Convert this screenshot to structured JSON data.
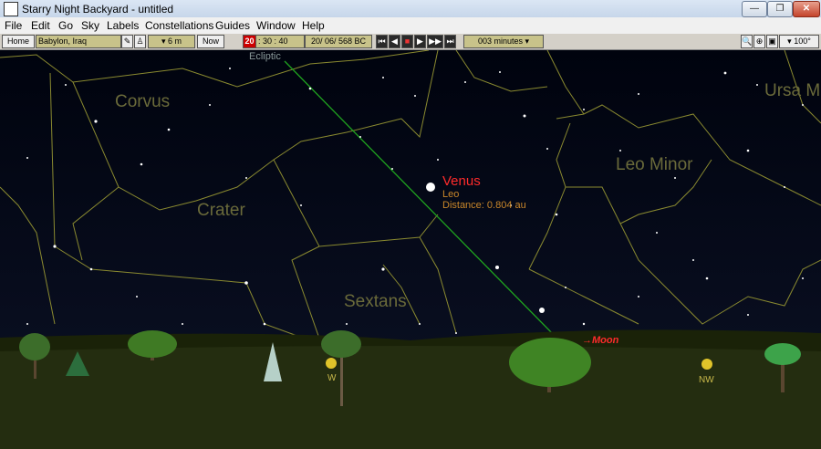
{
  "window": {
    "title": "Starry Night Backyard - untitled",
    "minimize_label": "—",
    "maximize_label": "❐",
    "close_label": "✕"
  },
  "menu": [
    "File",
    "Edit",
    "Go",
    "Sky",
    "Labels",
    "Constellations",
    "Guides",
    "Window",
    "Help"
  ],
  "toolbar": {
    "home_label": "Home",
    "location": "Babylon, Iraq",
    "elevation": "▾ 6 m",
    "now_label": "Now",
    "time_hour": "20",
    "time_rest": ": 30 : 40",
    "date": "20/ 06/  568 BC",
    "step": "003 minutes ▾",
    "fov": "▾ 100°"
  },
  "sky": {
    "constellation_labels": [
      "Corvus",
      "Crater",
      "Sextans",
      "Leo Minor",
      "Ursa M"
    ],
    "ecliptic_label": "Ecliptic",
    "venus": {
      "name": "Venus",
      "constellation": "Leo",
      "distance": "Distance: 0.804 au"
    },
    "moon_label": "→Moon",
    "compass": [
      "W",
      "NW"
    ]
  },
  "colors": {
    "sky": "#000817",
    "constellation_lines": "#8a8a30",
    "ecliptic": "#1fa21f",
    "ground": "#1a2208",
    "hill": "#242d10"
  }
}
